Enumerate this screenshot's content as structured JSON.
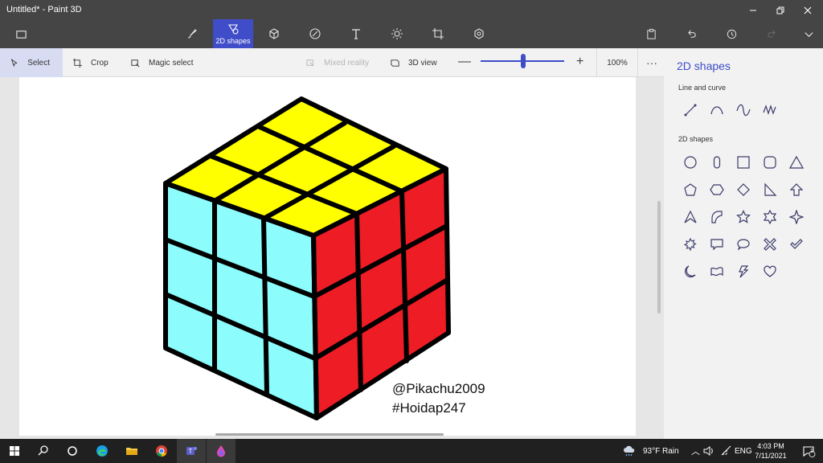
{
  "window": {
    "title": "Untitled* - Paint 3D"
  },
  "toolbar": {
    "items": [
      {
        "name": "brushes",
        "label": ""
      },
      {
        "name": "2d-shapes",
        "label": "2D shapes"
      },
      {
        "name": "3d-shapes",
        "label": ""
      },
      {
        "name": "stickers",
        "label": ""
      },
      {
        "name": "text",
        "label": ""
      },
      {
        "name": "effects",
        "label": ""
      },
      {
        "name": "canvas",
        "label": ""
      },
      {
        "name": "3d-library",
        "label": ""
      }
    ],
    "right": [
      "paste",
      "undo",
      "history",
      "redo",
      "expand"
    ]
  },
  "subtoolbar": {
    "select": "Select",
    "crop": "Crop",
    "magic_select": "Magic select",
    "mixed_reality": "Mixed reality",
    "view_3d": "3D view",
    "zoom_percent": "100%",
    "zoom_level": 0.5
  },
  "canvas": {
    "watermark_line1": "@Pikachu2009",
    "watermark_line2": "#Hoidap247",
    "cube_colors": {
      "top": "#ffff00",
      "left": "#8cfcfc",
      "right": "#ee1c24",
      "edge": "#000000"
    }
  },
  "panel": {
    "title": "2D shapes",
    "section_lines": "Line and curve",
    "section_shapes": "2D shapes",
    "lines": [
      "line-icon",
      "curve-icon",
      "two-point-curve-icon",
      "three-point-curve-icon"
    ],
    "shapes": [
      "circle-icon",
      "capsule-icon",
      "square-icon",
      "rounded-square-icon",
      "triangle-icon",
      "pentagon-icon",
      "hexagon-icon",
      "diamond-icon",
      "right-triangle-icon",
      "arrow-up-icon",
      "arrowhead-icon",
      "quarter-circle-icon",
      "star-five-icon",
      "star-six-icon",
      "star-four-icon",
      "burst-icon",
      "speech-rect-icon",
      "speech-oval-icon",
      "cross-icon",
      "check-icon",
      "crescent-icon",
      "banner-icon",
      "lightning-icon",
      "heart-icon"
    ]
  },
  "taskbar": {
    "weather": "93°F  Rain",
    "language": "ENG",
    "time": "4:03 PM",
    "date": "7/11/2021",
    "notifications": "1"
  },
  "colors": {
    "accent": "#3f4dc9",
    "titlebar": "#454545",
    "taskbar": "#202020"
  }
}
